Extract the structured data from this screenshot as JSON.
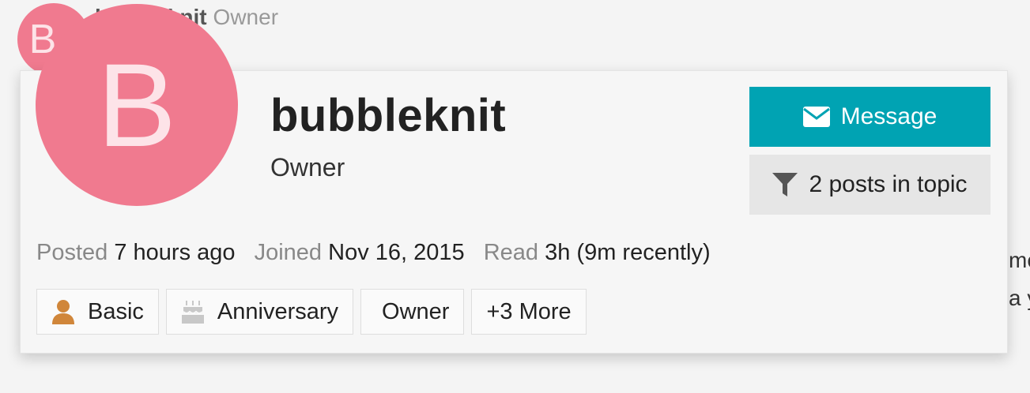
{
  "background_post": {
    "avatar_letter": "B",
    "username": "bubbleknit",
    "title": "Owner",
    "trailing_text_line1": "me",
    "trailing_text_line2": "a y"
  },
  "user_card": {
    "avatar_letter": "B",
    "avatar_color": "#f07a8f",
    "username": "bubbleknit",
    "title": "Owner",
    "message_button": {
      "label": "Message",
      "icon": "envelope-icon",
      "color": "#00a3b3"
    },
    "filter_button": {
      "label": "2 posts in topic",
      "icon": "filter-icon"
    },
    "stats": {
      "posted_label": "Posted",
      "posted_value": "7 hours ago",
      "joined_label": "Joined",
      "joined_value": "Nov 16, 2015",
      "read_label": "Read",
      "read_value": "3h (9m recently)"
    },
    "badges": [
      {
        "label": "Basic",
        "icon": "user-icon",
        "icon_color": "#d0863a"
      },
      {
        "label": "Anniversary",
        "icon": "cake-icon",
        "icon_color": "#c8c8c8"
      },
      {
        "label": "Owner"
      },
      {
        "label": "+3 More"
      }
    ]
  }
}
